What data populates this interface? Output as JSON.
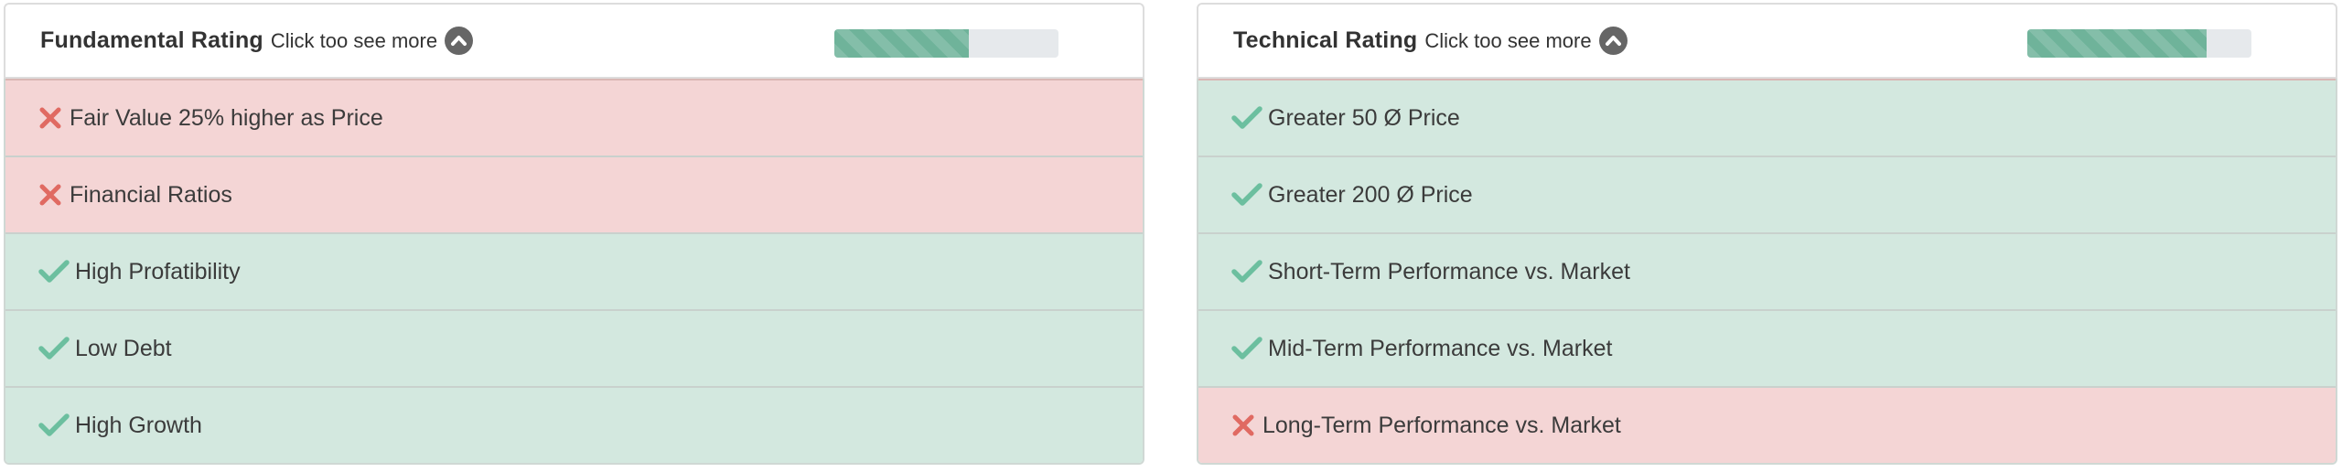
{
  "panels": [
    {
      "id": "fundamental",
      "title": "Fundamental Rating",
      "hint": "Click too see more",
      "rating_fraction": 0.6,
      "items": [
        {
          "label": "Fair Value 25% higher as Price",
          "status": "fail"
        },
        {
          "label": "Financial Ratios",
          "status": "fail"
        },
        {
          "label": "High Profatibility",
          "status": "pass"
        },
        {
          "label": "Low Debt",
          "status": "pass"
        },
        {
          "label": "High Growth",
          "status": "pass"
        }
      ]
    },
    {
      "id": "technical",
      "title": "Technical Rating",
      "hint": "Click too see more",
      "rating_fraction": 0.8,
      "items": [
        {
          "label": "Greater 50 Ø Price",
          "status": "pass"
        },
        {
          "label": "Greater 200 Ø Price",
          "status": "pass"
        },
        {
          "label": "Short-Term Performance vs. Market",
          "status": "pass"
        },
        {
          "label": "Mid-Term Performance vs. Market",
          "status": "pass"
        },
        {
          "label": "Long-Term Performance vs. Market",
          "status": "fail"
        }
      ]
    }
  ],
  "colors": {
    "pass_bg": "#d3e8df",
    "fail_bg": "#f4d5d5",
    "check": "#6cbf9f",
    "cross": "#e06a62",
    "bar_fill": "#6fb39a",
    "bar_track": "#e6e9ec"
  },
  "icons": {
    "pass": "check-icon",
    "fail": "cross-icon",
    "toggle": "chevron-up-circle-icon"
  }
}
